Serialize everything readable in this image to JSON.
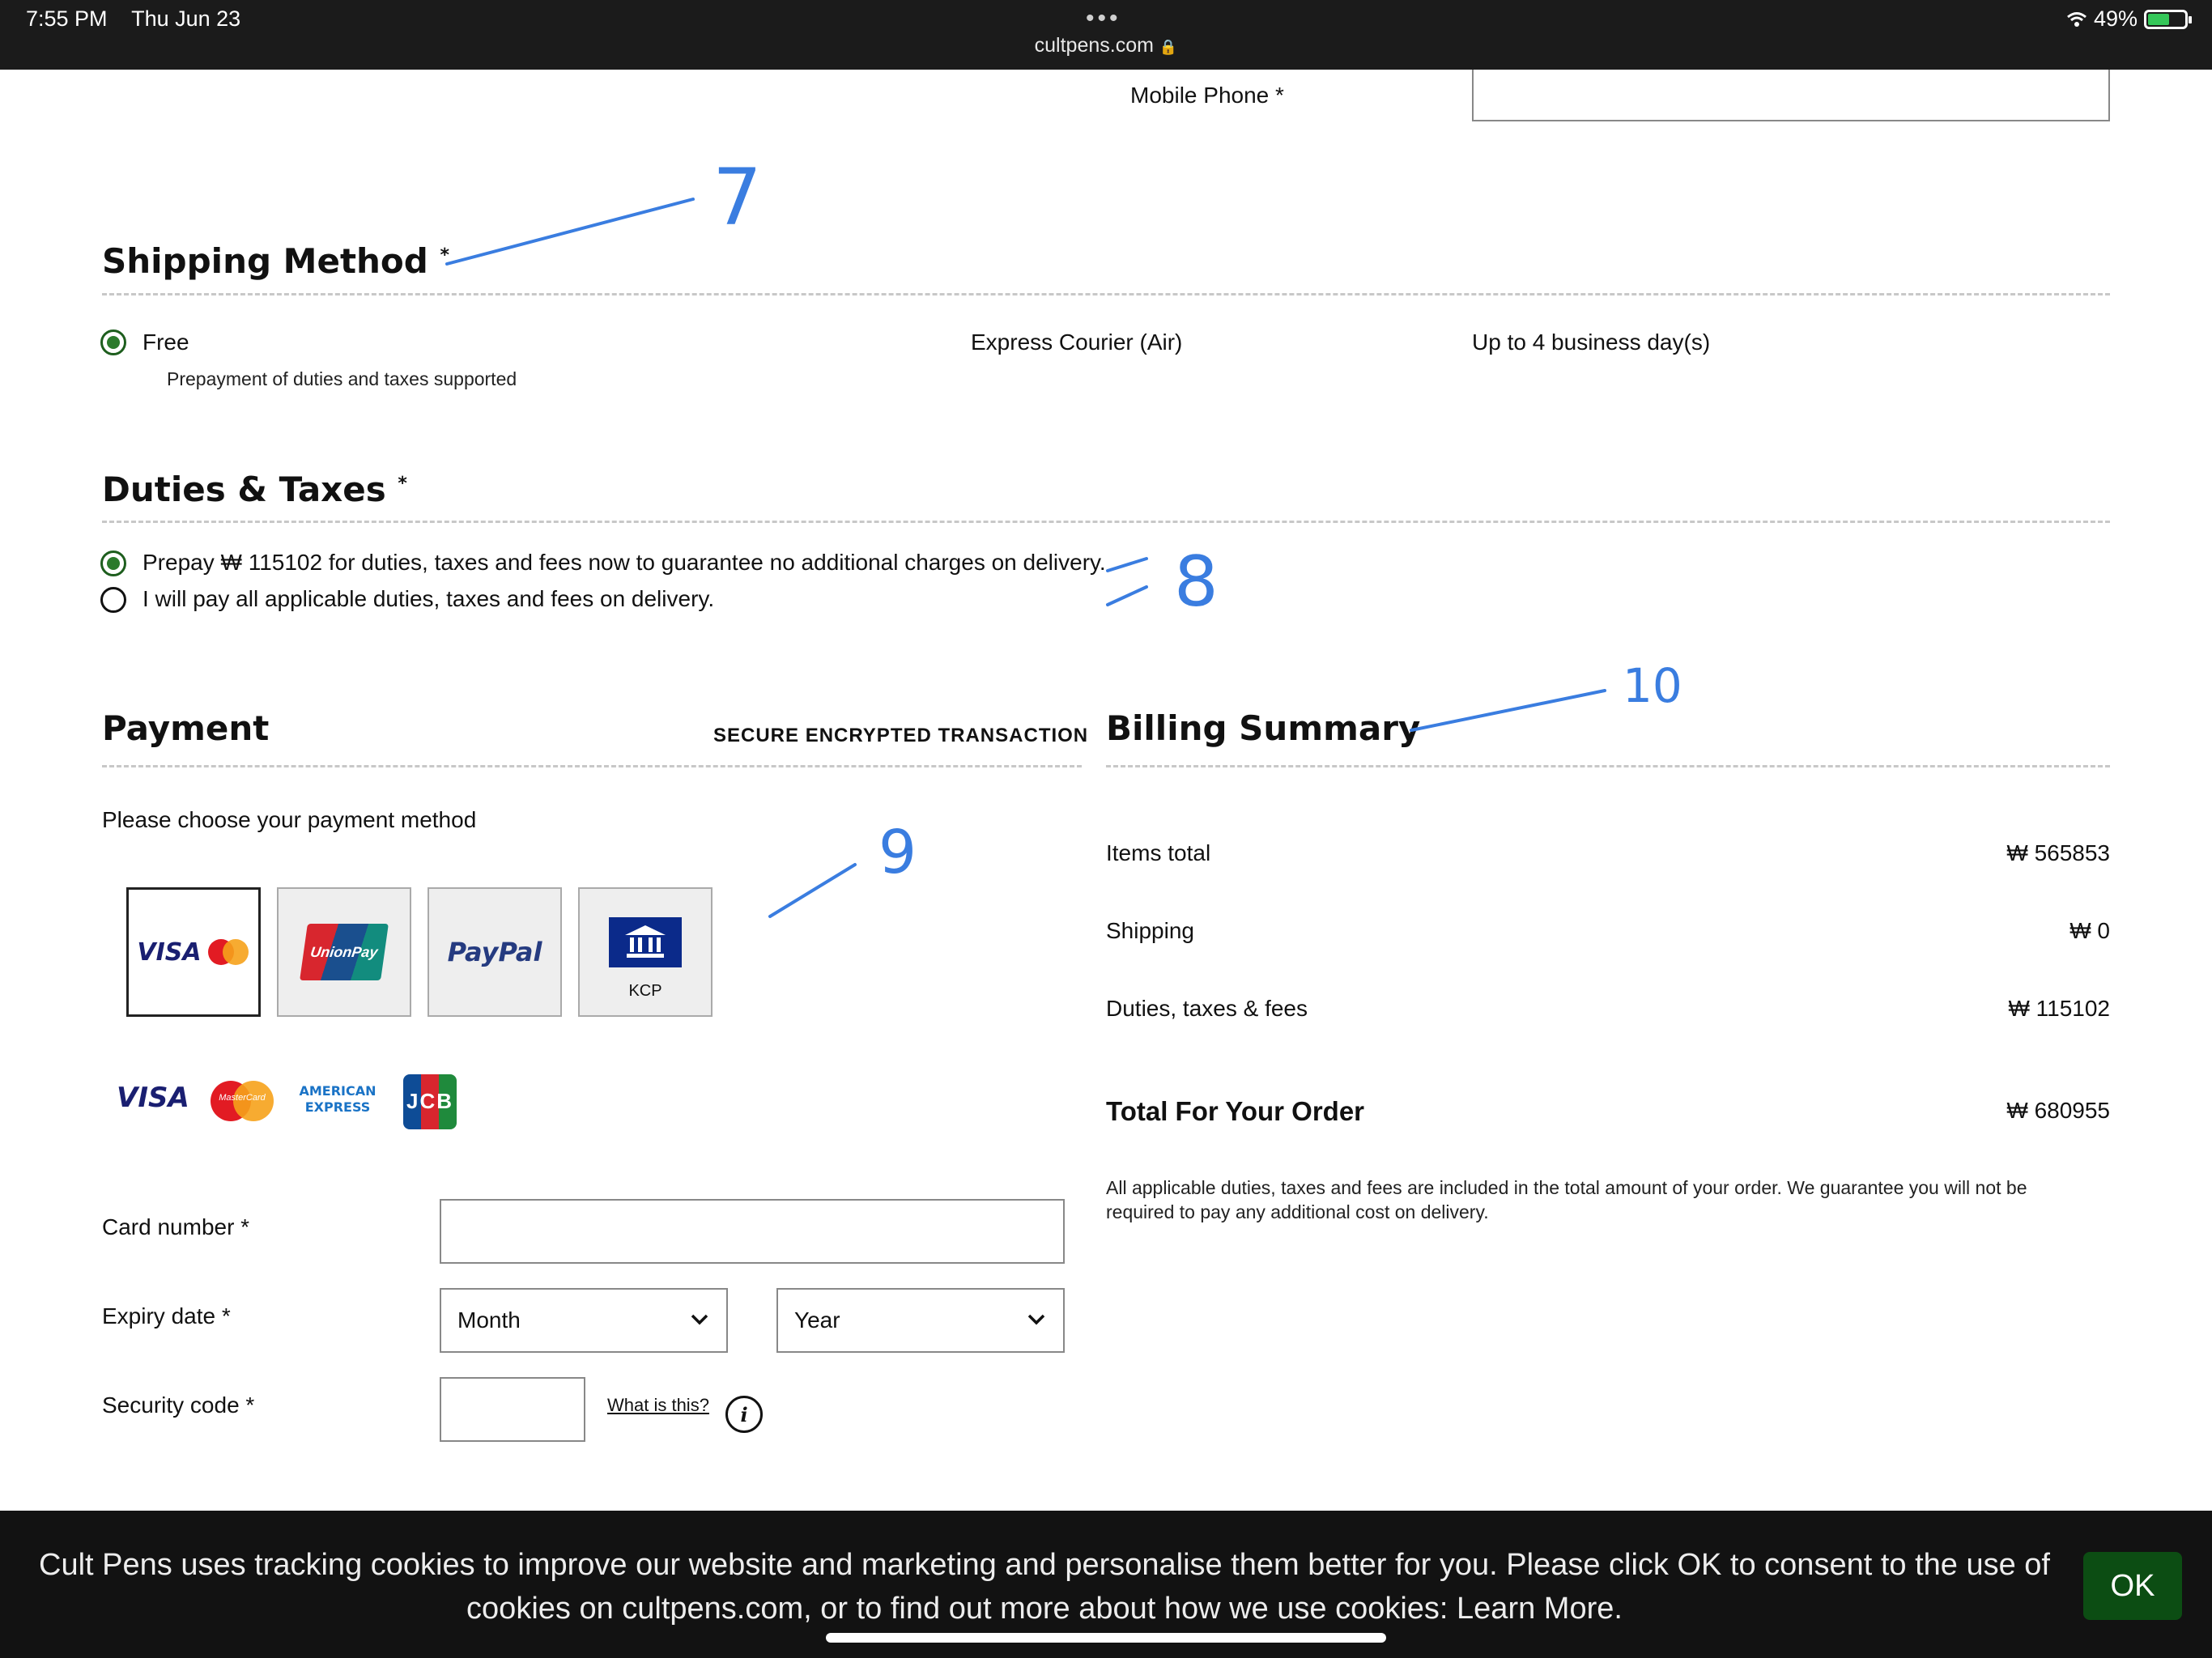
{
  "status_bar": {
    "time": "7:55 PM",
    "date": "Thu Jun 23",
    "url": "cultpens.com",
    "battery": "49%"
  },
  "contact": {
    "mobile_phone_label": "Mobile Phone *"
  },
  "shipping": {
    "title": "Shipping Method",
    "option_label": "Free",
    "option_note": "Prepayment of duties and taxes supported",
    "carrier": "Express Courier (Air)",
    "eta": "Up to 4 business day(s)"
  },
  "duties": {
    "title": "Duties & Taxes",
    "option_prepay": "Prepay ₩ 115102 for duties, taxes and fees now to guarantee no additional charges on delivery.",
    "option_pay_later": "I will pay all applicable duties, taxes and fees on delivery."
  },
  "payment": {
    "title": "Payment",
    "secure_label": "SECURE ENCRYPTED TRANSACTION",
    "prompt": "Please choose your payment method",
    "tiles": [
      "VISA",
      "UnionPay",
      "PayPal",
      "KCP"
    ],
    "card_brands": [
      "VISA",
      "MasterCard",
      "AMERICAN EXPRESS",
      "JCB"
    ],
    "card_number_label": "Card number *",
    "expiry_label": "Expiry date *",
    "month_placeholder": "Month",
    "year_placeholder": "Year",
    "security_label": "Security code *",
    "what_is_this": "What is this?"
  },
  "billing": {
    "title": "Billing Summary",
    "rows": [
      {
        "label": "Items total",
        "value": "₩ 565853"
      },
      {
        "label": "Shipping",
        "value": "₩ 0"
      },
      {
        "label": "Duties, taxes & fees",
        "value": "₩ 115102"
      }
    ],
    "total_label": "Total For Your Order",
    "total_value": "₩ 680955",
    "note": "All applicable duties, taxes and fees are included in the total amount of your order. We guarantee you will not be required to pay any additional cost on delivery."
  },
  "annotations": {
    "a7": "7",
    "a8": "8",
    "a9": "9",
    "a10": "10"
  },
  "cookie": {
    "message": "Cult Pens uses tracking cookies to improve our website and marketing and personalise them better for you. Please click OK to consent to the use of cookies on cultpens.com, or to find out more about how we use cookies: Learn More.",
    "ok": "OK"
  },
  "colors": {
    "accent_green": "#0c4d13",
    "annotation_blue": "#3a7de0"
  }
}
